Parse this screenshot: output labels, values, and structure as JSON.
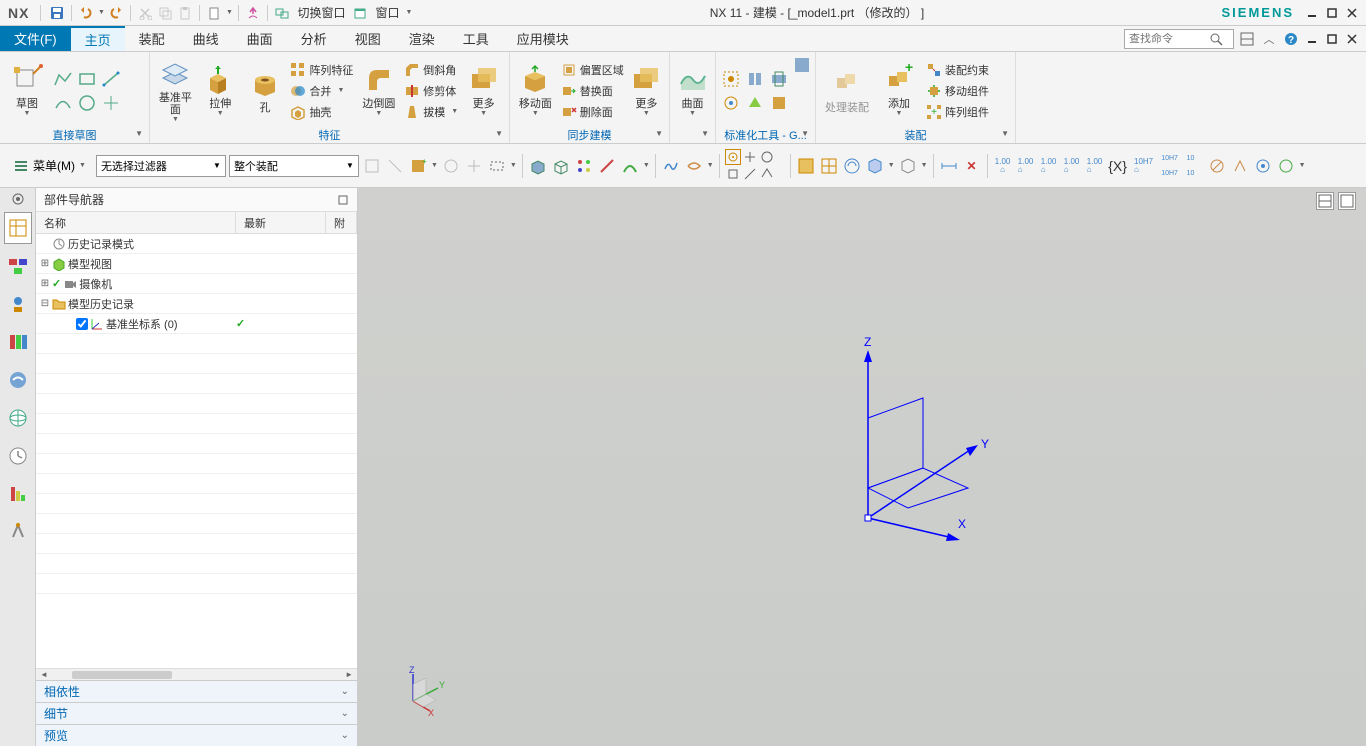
{
  "app": {
    "logo": "NX",
    "title": "NX 11 - 建模 - [_model1.prt （修改的） ]",
    "brand": "SIEMENS"
  },
  "titlebar": {
    "switch_window": "切换窗口",
    "window": "窗口"
  },
  "menu": {
    "file": "文件(F)",
    "home": "主页",
    "assembly": "装配",
    "curve": "曲线",
    "surface": "曲面",
    "analysis": "分析",
    "view": "视图",
    "render": "渲染",
    "tools": "工具",
    "application": "应用模块",
    "search_placeholder": "查找命令"
  },
  "ribbon": {
    "sketch": "草图",
    "direct_sketch": "直接草图",
    "datum_plane": "基准平面",
    "extrude": "拉伸",
    "hole": "孔",
    "pattern": "阵列特征",
    "combine": "合并",
    "shell": "抽壳",
    "edge_blend": "边倒圆",
    "chamfer": "倒斜角",
    "trim_body": "修剪体",
    "draft": "拔模",
    "more": "更多",
    "feature": "特征",
    "move_face": "移动面",
    "offset_region": "偏置区域",
    "replace_face": "替换面",
    "delete_face": "删除面",
    "sync_model": "同步建模",
    "surface_btn": "曲面",
    "std_tools": "标准化工具 - G...",
    "process_assembly": "处理装配",
    "add": "添加",
    "assembly_constraint": "装配约束",
    "move_component": "移动组件",
    "pattern_component": "阵列组件",
    "assembly_group": "装配"
  },
  "toolbar2": {
    "menu_btn": "菜单(M)",
    "filter1": "无选择过滤器",
    "filter2": "整个装配"
  },
  "nav": {
    "title": "部件导航器",
    "col_name": "名称",
    "col_latest": "最新",
    "col_att": "附",
    "history_mode": "历史记录模式",
    "model_view": "模型视图",
    "camera": "摄像机",
    "model_history": "模型历史记录",
    "datum_csys": "基准坐标系 (0)",
    "dependency": "相依性",
    "detail": "细节",
    "preview": "预览"
  },
  "coords": {
    "x": "X",
    "y": "Y",
    "z": "Z"
  }
}
